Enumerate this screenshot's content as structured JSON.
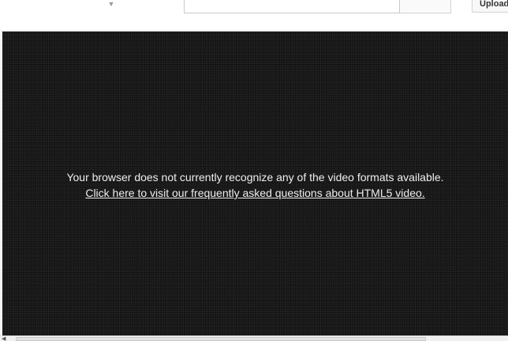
{
  "header": {
    "guide_arrow_icon": "chevron-down-icon",
    "search": {
      "value": "",
      "placeholder": ""
    },
    "upload_label": "Upload"
  },
  "player": {
    "message": "Your browser does not currently recognize any of the video formats available.",
    "faq_link": "Click here to visit our frequently asked questions about HTML5 video.",
    "background_color": "#151515",
    "text_color": "#eeeeee"
  }
}
